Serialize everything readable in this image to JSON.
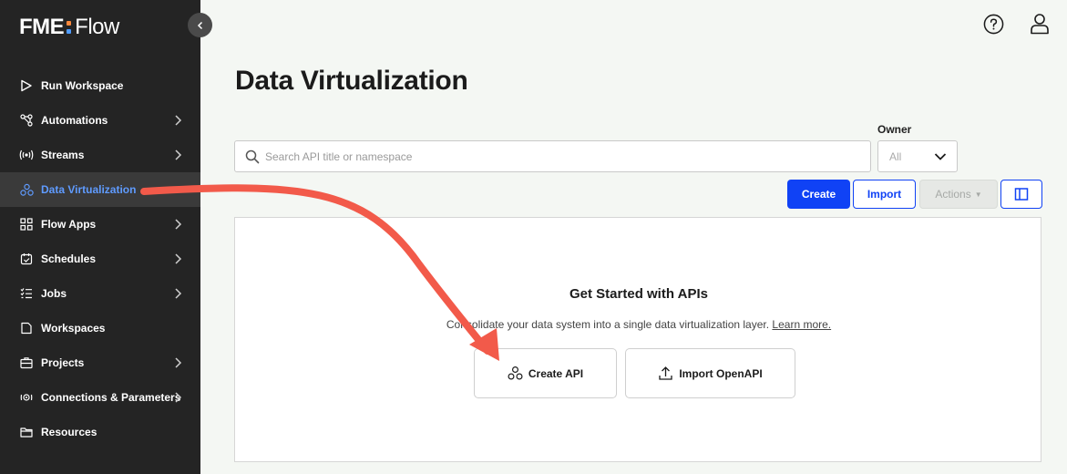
{
  "brand": {
    "name_a": "FME",
    "name_b": "Flow"
  },
  "sidebar": {
    "items": [
      {
        "label": "Run Workspace",
        "icon": "play-icon",
        "chevron": false,
        "active": false
      },
      {
        "label": "Automations",
        "icon": "automations-icon",
        "chevron": true,
        "active": false
      },
      {
        "label": "Streams",
        "icon": "streams-icon",
        "chevron": true,
        "active": false
      },
      {
        "label": "Data Virtualization",
        "icon": "data-virtualization-icon",
        "chevron": false,
        "active": true
      },
      {
        "label": "Flow Apps",
        "icon": "apps-grid-icon",
        "chevron": true,
        "active": false
      },
      {
        "label": "Schedules",
        "icon": "calendar-icon",
        "chevron": true,
        "active": false
      },
      {
        "label": "Jobs",
        "icon": "jobs-list-icon",
        "chevron": true,
        "active": false
      },
      {
        "label": "Workspaces",
        "icon": "document-icon",
        "chevron": false,
        "active": false
      },
      {
        "label": "Projects",
        "icon": "briefcase-icon",
        "chevron": true,
        "active": false
      },
      {
        "label": "Connections & Parameters",
        "icon": "connections-icon",
        "chevron": true,
        "active": false
      },
      {
        "label": "Resources",
        "icon": "folder-icon",
        "chevron": false,
        "active": false
      }
    ]
  },
  "header": {
    "help_icon": "help-icon",
    "user_icon": "user-icon"
  },
  "main": {
    "title": "Data Virtualization",
    "search": {
      "placeholder": "Search API title or namespace",
      "value": ""
    },
    "owner": {
      "label": "Owner",
      "selected": "All"
    },
    "toolbar": {
      "create": "Create",
      "import": "Import",
      "actions": "Actions"
    },
    "empty_state": {
      "title": "Get Started with APIs",
      "description": "Consolidate your data system into a single data virtualization layer.",
      "link": "Learn more.",
      "create_button": "Create API",
      "import_button": "Import OpenAPI"
    }
  },
  "colors": {
    "sidebar": "#242424",
    "accent": "#1042f5",
    "active_text": "#5f9bff",
    "annotation_arrow": "#f25a4a"
  }
}
